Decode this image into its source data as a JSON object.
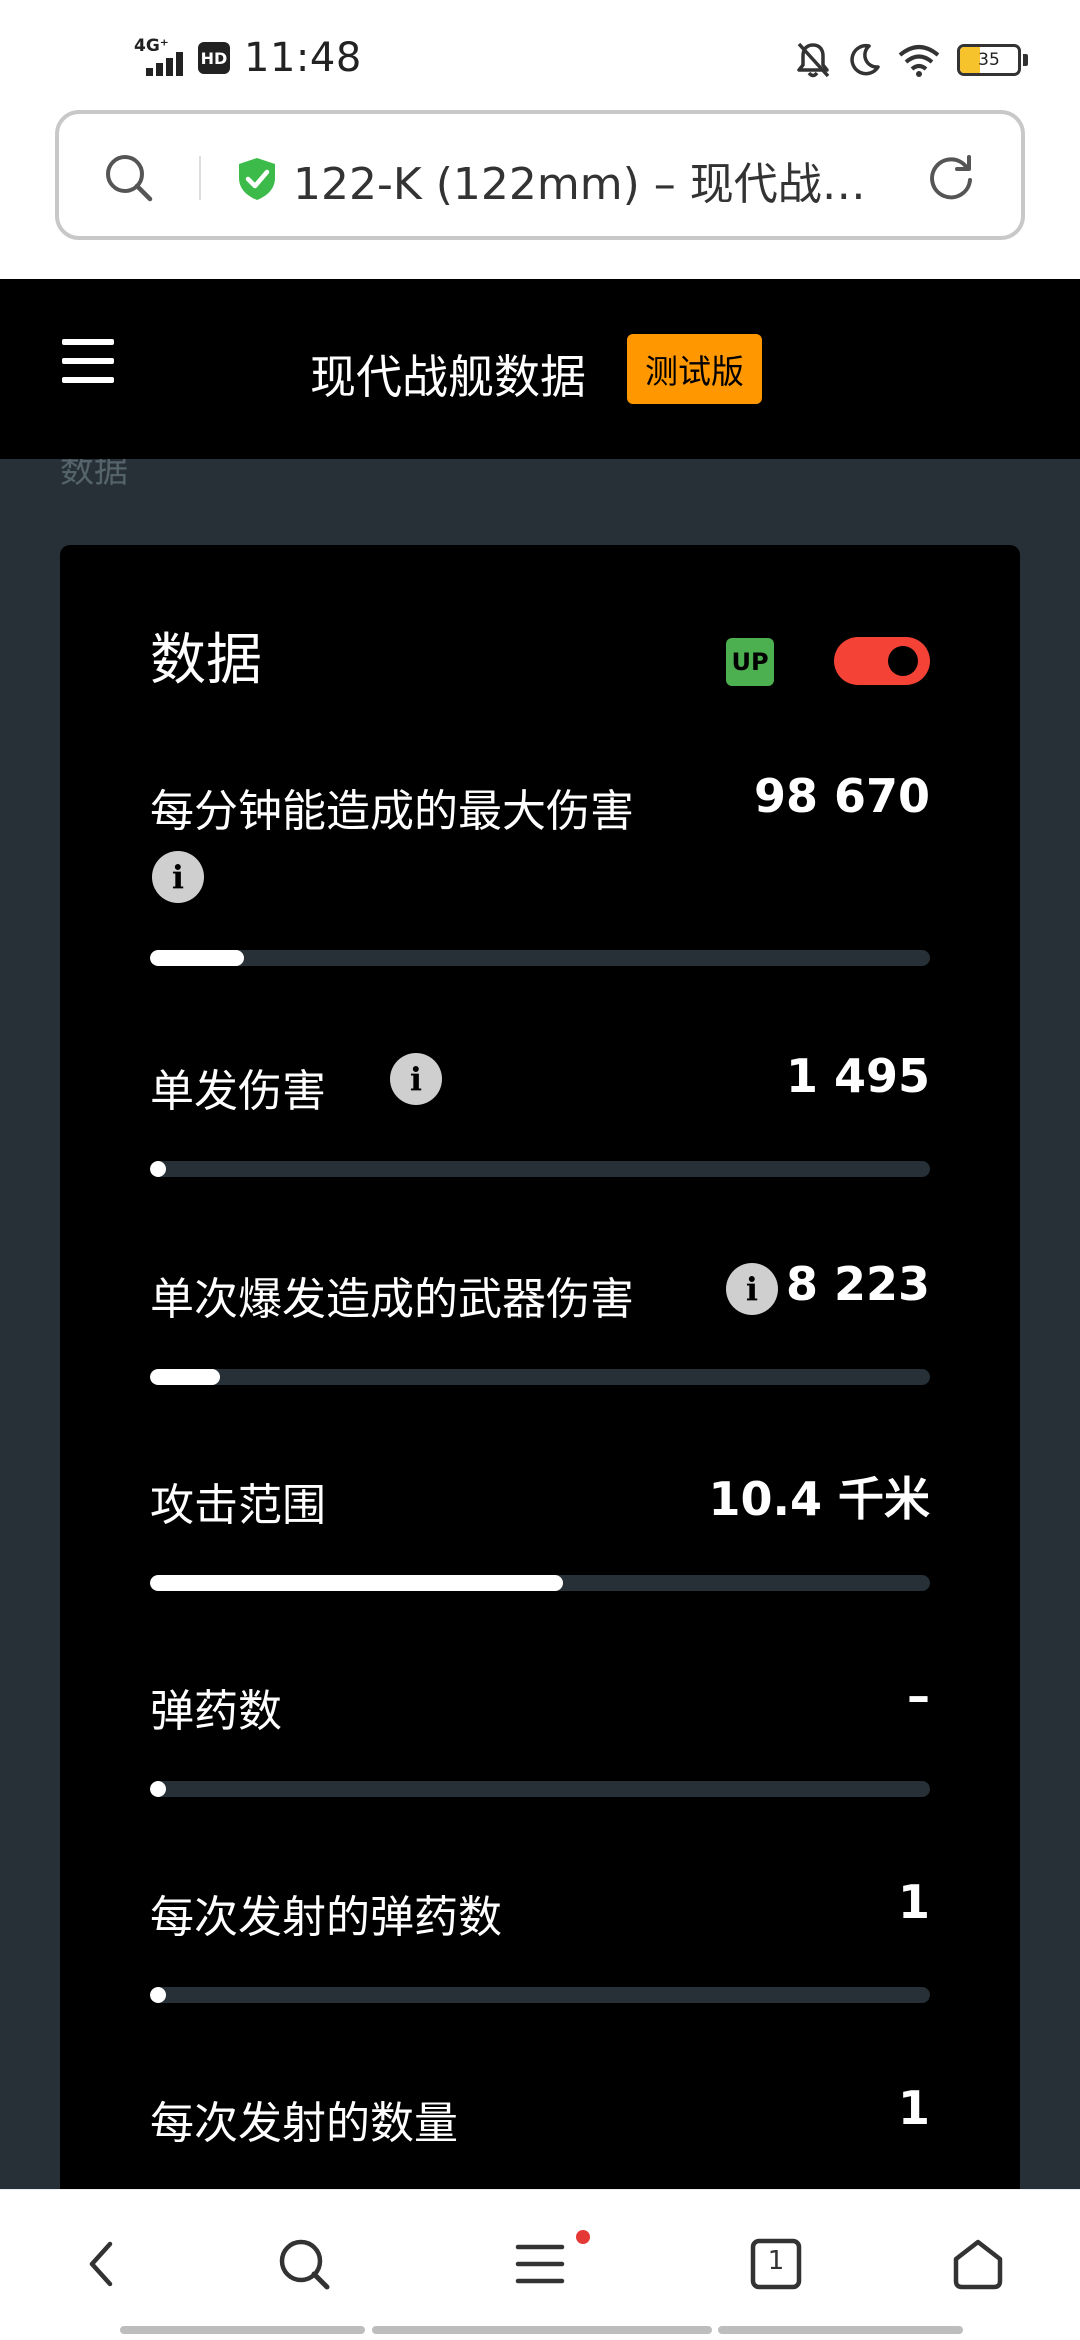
{
  "status_bar": {
    "network": "4G⁺",
    "hd": "HD",
    "time": "11:48",
    "battery": "35",
    "battery_level": 0.35
  },
  "browser": {
    "address_title": "122-K (122mm) – 现代战…"
  },
  "site": {
    "title": "现代战舰数据",
    "beta_label": "测试版"
  },
  "content": {
    "faded_text": "数据"
  },
  "card": {
    "title": "数据",
    "up_badge": "UP",
    "toggle_on": true,
    "stats": [
      {
        "label": "每分钟能造成的最大伤害",
        "value": "98 670",
        "has_info": true,
        "level": 0.12
      },
      {
        "label": "单发伤害",
        "value": "1 495",
        "has_info": true,
        "level": 0.02
      },
      {
        "label": "单次爆发造成的武器伤害",
        "value": "8 223",
        "has_info": true,
        "level": 0.09
      },
      {
        "label": "攻击范围",
        "value": "10.4 千米",
        "has_info": false,
        "level": 0.53
      },
      {
        "label": "弹药数",
        "value": "–",
        "has_info": false,
        "level": 0.02
      },
      {
        "label": "每次发射的弹药数",
        "value": "1",
        "has_info": false,
        "level": 0.02
      },
      {
        "label": "每次发射的数量",
        "value": "1",
        "has_info": false,
        "level": 0.02
      }
    ]
  },
  "bottom_nav": {
    "tab_count": "1"
  },
  "colors": {
    "accent_orange": "#ff9800",
    "toggle_red": "#f44336",
    "up_green": "#4caf50",
    "shield_green": "#3dbb4a",
    "content_bg": "#263036"
  }
}
